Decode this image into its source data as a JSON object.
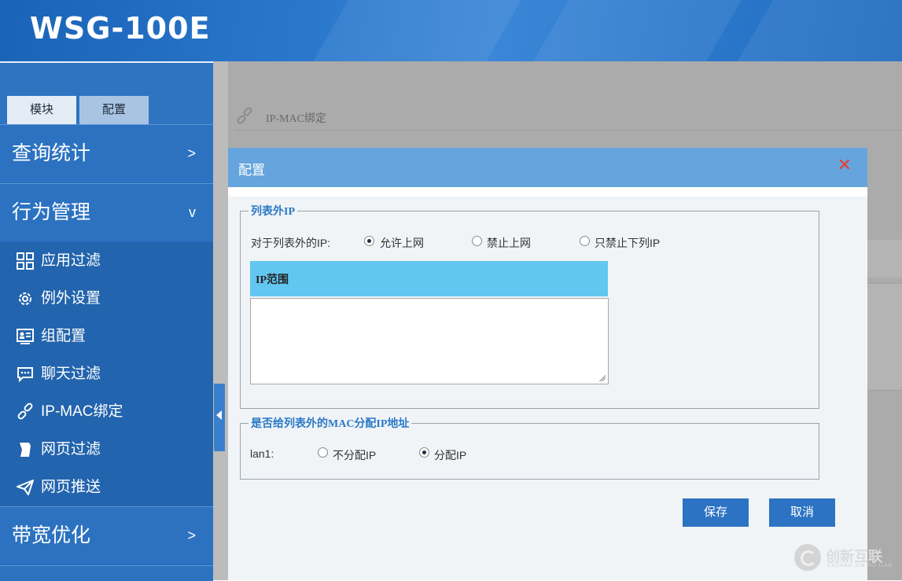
{
  "header": {
    "title": "WSG-100E"
  },
  "sidebar": {
    "tabs": [
      {
        "label": "模块"
      },
      {
        "label": "配置"
      }
    ],
    "groups": [
      {
        "label": "查询统计",
        "chevron": ">"
      },
      {
        "label": "行为管理",
        "chevron": "v"
      },
      {
        "label": "带宽优化",
        "chevron": ">"
      }
    ],
    "items": [
      {
        "label": "应用过滤",
        "icon": "grid-icon"
      },
      {
        "label": "例外设置",
        "icon": "gear-icon"
      },
      {
        "label": "组配置",
        "icon": "group-card-icon"
      },
      {
        "label": "聊天过滤",
        "icon": "chat-icon"
      },
      {
        "label": "IP-MAC绑定",
        "icon": "link-icon"
      },
      {
        "label": "网页过滤",
        "icon": "page-icon"
      },
      {
        "label": "网页推送",
        "icon": "send-icon"
      }
    ]
  },
  "background": {
    "page_title": "IP-MAC绑定"
  },
  "modal": {
    "title": "配置",
    "close": "✕",
    "section1": {
      "legend": "列表外IP",
      "prompt": "对于列表外的IP:",
      "options": [
        "允许上网",
        "禁止上网",
        "只禁止下列IP"
      ],
      "selected": "允许上网",
      "table_header": "IP范围",
      "textarea_value": ""
    },
    "section2": {
      "legend": "是否给列表外的MAC分配IP地址",
      "label": "lan1:",
      "options": [
        "不分配IP",
        "分配IP"
      ],
      "selected": "分配IP"
    },
    "buttons": {
      "save": "保存",
      "cancel": "取消"
    }
  },
  "watermark": {
    "text": "创新互联",
    "sub": "CHUANG XIN HU LIAN"
  }
}
